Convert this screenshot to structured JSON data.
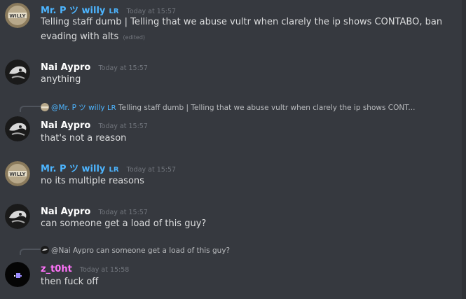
{
  "colors": {
    "background": "#36393f",
    "user_blue": "#4db5ff",
    "user_white": "#ffffff",
    "user_pink": "#ff73fa",
    "timestamp": "#72767d",
    "text": "#dcddde"
  },
  "messages": [
    {
      "author": "Mr. P ツ willy",
      "tag": "LR",
      "time": "Today at 15:57",
      "text": "Telling staff dumb | Telling that we abuse vultr when clarely the ip shows CONTABO, ban evading with alts",
      "edited": "(edited)"
    },
    {
      "author": "Nai Aypro",
      "time": "Today at 15:57",
      "text": "anything"
    },
    {
      "reply": {
        "mention": "@Mr. P ツ willy",
        "tag": "LR",
        "preview": "Telling staff dumb | Telling that we abuse vultr when clarely the ip shows CONT..."
      },
      "author": "Nai Aypro",
      "time": "Today at 15:57",
      "text": "that's not a reason"
    },
    {
      "author": "Mr. P ツ willy",
      "tag": "LR",
      "time": "Today at 15:57",
      "text": "no its multiple reasons"
    },
    {
      "author": "Nai Aypro",
      "time": "Today at 15:57",
      "text": "can someone get a load of this guy?"
    },
    {
      "reply": {
        "mention": "@Nai Aypro",
        "preview": "can someone get a load of this guy?"
      },
      "author": "z_t0ht",
      "time": "Today at 15:58",
      "text": "then fuck off"
    }
  ]
}
